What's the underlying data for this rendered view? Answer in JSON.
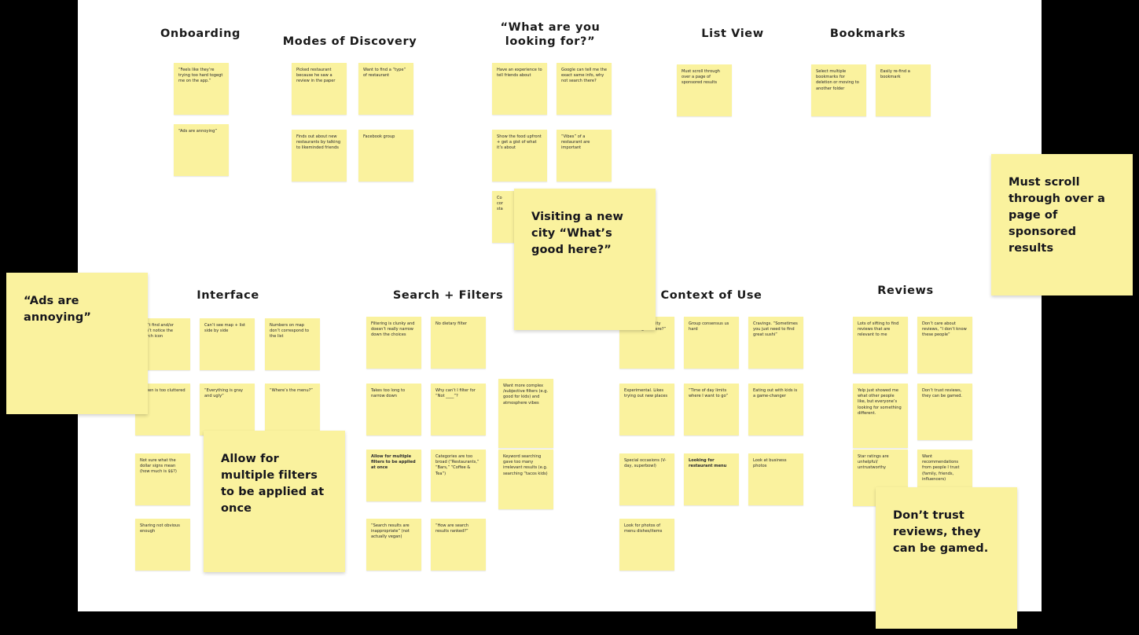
{
  "board": {
    "background": "#000000",
    "canvas_color": "#ffffff",
    "note_color": "#FAF29E"
  },
  "sections": [
    {
      "id": "onboarding",
      "title": "Onboarding",
      "notes": [
        {
          "text": "“Feels like they’re trying too hard togegt me on the app.”",
          "bold": false
        },
        {
          "text": "“Ads are annoying”",
          "bold": false
        }
      ]
    },
    {
      "id": "modes-of-discovery",
      "title": "Modes of Discovery",
      "notes": [
        {
          "text": "Picked restaurant because he saw a review in the paper",
          "bold": false
        },
        {
          "text": "Want to find a “type” of restaurant",
          "bold": false
        },
        {
          "text": "Finds out about new restaurants by talking to likeminded friends",
          "bold": false
        },
        {
          "text": "Facebook group",
          "bold": false
        }
      ]
    },
    {
      "id": "what-are-you-looking-for",
      "title": "“What are you\nlooking for?”",
      "notes": [
        {
          "text": "Have an experience to tell friends about",
          "bold": false
        },
        {
          "text": "Google can tell me the exact same info, why not search there?",
          "bold": false
        },
        {
          "text": "Show the food upfront + get a gist of what it’s about",
          "bold": false
        },
        {
          "text": "“Vibes” of a restaurant are important",
          "bold": false
        },
        {
          "text": "Co\ncor\nsta",
          "bold": false
        }
      ]
    },
    {
      "id": "list-view",
      "title": "List View",
      "notes": [
        {
          "text": "Must scroll through over a page of sponsored results",
          "bold": false
        }
      ]
    },
    {
      "id": "bookmarks",
      "title": "Bookmarks",
      "notes": [
        {
          "text": "Select multiple bookmarks for deletion or moving to another folder",
          "bold": false
        },
        {
          "text": "Easily re-find a bookmark",
          "bold": false
        }
      ]
    },
    {
      "id": "interface",
      "title": "Interface",
      "notes": [
        {
          "text": "Can’t find and/or didn’t notice the search icon",
          "bold": false
        },
        {
          "text": "Can’t see map + list side by side",
          "bold": false
        },
        {
          "text": "Numbers on map don’t correspond to the list",
          "bold": false
        },
        {
          "text": "Screen is too cluttered",
          "bold": false
        },
        {
          "text": "“Everything is gray and ugly”",
          "bold": false
        },
        {
          "text": "“Where’s the menu?”",
          "bold": false
        },
        {
          "text": "Not sure what the dollar signs mean (how much is $$?)",
          "bold": false
        },
        {
          "text": "Sharing not obvious enough",
          "bold": false
        }
      ]
    },
    {
      "id": "search-filters",
      "title": "Search + Filters",
      "notes": [
        {
          "text": "Filtering is clunky and doesn’t really narrow down the choices",
          "bold": false
        },
        {
          "text": "No dietary filter",
          "bold": false
        },
        {
          "text": "Takes too long to narrow down",
          "bold": false
        },
        {
          "text": "Why can’t I filter for “Not ____”?",
          "bold": false
        },
        {
          "text": "Want more complex /subjective filters (e.g. good for kids) and atmosphere vibes",
          "bold": false
        },
        {
          "text": "Allow for multiple filters to be applied at once",
          "bold": true
        },
        {
          "text": "Categories are too broad (“Restaurants,” “Bars,” “Coffee & Tea”)",
          "bold": false
        },
        {
          "text": "Keyword searching gave too many irrelevant results (e.g. searching “tacos kids)",
          "bold": false
        },
        {
          "text": "“Search results are inappropriate” (not actually vegan)",
          "bold": false
        },
        {
          "text": "“How are search results ranked?”",
          "bold": false
        }
      ]
    },
    {
      "id": "context-of-use",
      "title": "Context of Use",
      "notes": [
        {
          "text": "Visiting a new city “What’s good here?”",
          "bold": false
        },
        {
          "text": "Group consensus us hard",
          "bold": false
        },
        {
          "text": "Cravings. “Sometimes you just need to find great sushi”",
          "bold": false
        },
        {
          "text": "Experimental. Likes trying out new places",
          "bold": false
        },
        {
          "text": "“Time of day limits where I want to go”",
          "bold": false
        },
        {
          "text": "Eating out with kids is a game-changer",
          "bold": false
        },
        {
          "text": "Special occasions (V-day, superbowl)",
          "bold": false
        },
        {
          "text": "Looking for restaurant menu",
          "bold": true
        },
        {
          "text": "Look at business photos",
          "bold": false
        },
        {
          "text": "Look for photos of menu dishes/items",
          "bold": false
        }
      ]
    },
    {
      "id": "reviews",
      "title": "Reviews",
      "notes": [
        {
          "text": "Lots of sifting to find reviews that are relevant to me",
          "bold": false
        },
        {
          "text": "Don’t care about reviews, “I don’t know these people”",
          "bold": false
        },
        {
          "text": "Yelp just showed me what other people like, but everyone’s looking for something different.",
          "bold": false
        },
        {
          "text": "Don’t trust reviews, they can be gamed.",
          "bold": false
        },
        {
          "text": "Star ratings are unhelpful/ untrustworthy",
          "bold": false
        },
        {
          "text": "Want recommendations from people I trust (family, friends, influencers)",
          "bold": false
        }
      ]
    }
  ],
  "callouts": [
    {
      "id": "callout-ads-are-annoying",
      "text": "“Ads are annoying”"
    },
    {
      "id": "callout-visiting-new-city",
      "text": "Visiting a new city “What’s good here?”"
    },
    {
      "id": "callout-must-scroll",
      "text": "Must scroll through over a page of sponsored results"
    },
    {
      "id": "callout-allow-multiple-filters",
      "text": "Allow for multiple filters to be applied at once"
    },
    {
      "id": "callout-dont-trust-reviews",
      "text": "Don’t trust reviews, they can be gamed."
    }
  ]
}
